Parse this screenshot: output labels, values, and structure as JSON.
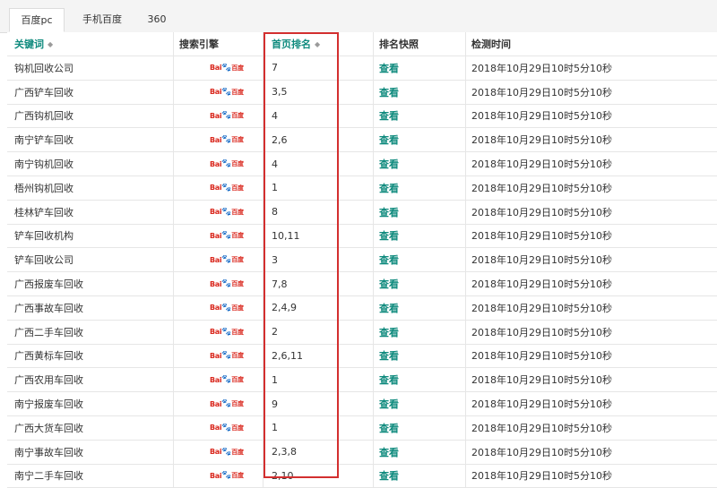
{
  "tabs": [
    {
      "label": "百度pc",
      "active": true
    },
    {
      "label": "手机百度",
      "active": false
    },
    {
      "label": "360",
      "active": false
    }
  ],
  "columns": {
    "keyword": "关键词",
    "engine": "搜索引擎",
    "rank": "首页排名",
    "snapshot": "排名快照",
    "time": "检测时间"
  },
  "engine_logo": {
    "left": "Bai",
    "paw": "🐾",
    "right": "百度",
    "icon": "baidu-logo"
  },
  "highlight_color": "#d32f2f",
  "link_color": "#0e8a7d",
  "rows": [
    {
      "keyword": "钩机回收公司",
      "rank": "7",
      "snapshot": "查看",
      "time": "2018年10月29日10时5分10秒"
    },
    {
      "keyword": "广西铲车回收",
      "rank": "3,5",
      "snapshot": "查看",
      "time": "2018年10月29日10时5分10秒"
    },
    {
      "keyword": "广西钩机回收",
      "rank": "4",
      "snapshot": "查看",
      "time": "2018年10月29日10时5分10秒"
    },
    {
      "keyword": "南宁铲车回收",
      "rank": "2,6",
      "snapshot": "查看",
      "time": "2018年10月29日10时5分10秒"
    },
    {
      "keyword": "南宁钩机回收",
      "rank": "4",
      "snapshot": "查看",
      "time": "2018年10月29日10时5分10秒"
    },
    {
      "keyword": "梧州钩机回收",
      "rank": "1",
      "snapshot": "查看",
      "time": "2018年10月29日10时5分10秒"
    },
    {
      "keyword": "桂林铲车回收",
      "rank": "8",
      "snapshot": "查看",
      "time": "2018年10月29日10时5分10秒"
    },
    {
      "keyword": "铲车回收机构",
      "rank": "10,11",
      "snapshot": "查看",
      "time": "2018年10月29日10时5分10秒"
    },
    {
      "keyword": "铲车回收公司",
      "rank": "3",
      "snapshot": "查看",
      "time": "2018年10月29日10时5分10秒"
    },
    {
      "keyword": "广西报废车回收",
      "rank": "7,8",
      "snapshot": "查看",
      "time": "2018年10月29日10时5分10秒"
    },
    {
      "keyword": "广西事故车回收",
      "rank": "2,4,9",
      "snapshot": "查看",
      "time": "2018年10月29日10时5分10秒"
    },
    {
      "keyword": "广西二手车回收",
      "rank": "2",
      "snapshot": "查看",
      "time": "2018年10月29日10时5分10秒"
    },
    {
      "keyword": "广西黄标车回收",
      "rank": "2,6,11",
      "snapshot": "查看",
      "time": "2018年10月29日10时5分10秒"
    },
    {
      "keyword": "广西农用车回收",
      "rank": "1",
      "snapshot": "查看",
      "time": "2018年10月29日10时5分10秒"
    },
    {
      "keyword": "南宁报废车回收",
      "rank": "9",
      "snapshot": "查看",
      "time": "2018年10月29日10时5分10秒"
    },
    {
      "keyword": "广西大货车回收",
      "rank": "1",
      "snapshot": "查看",
      "time": "2018年10月29日10时5分10秒"
    },
    {
      "keyword": "南宁事故车回收",
      "rank": "2,3,8",
      "snapshot": "查看",
      "time": "2018年10月29日10时5分10秒"
    },
    {
      "keyword": "南宁二手车回收",
      "rank": "2,10",
      "snapshot": "查看",
      "time": "2018年10月29日10时5分10秒"
    }
  ]
}
